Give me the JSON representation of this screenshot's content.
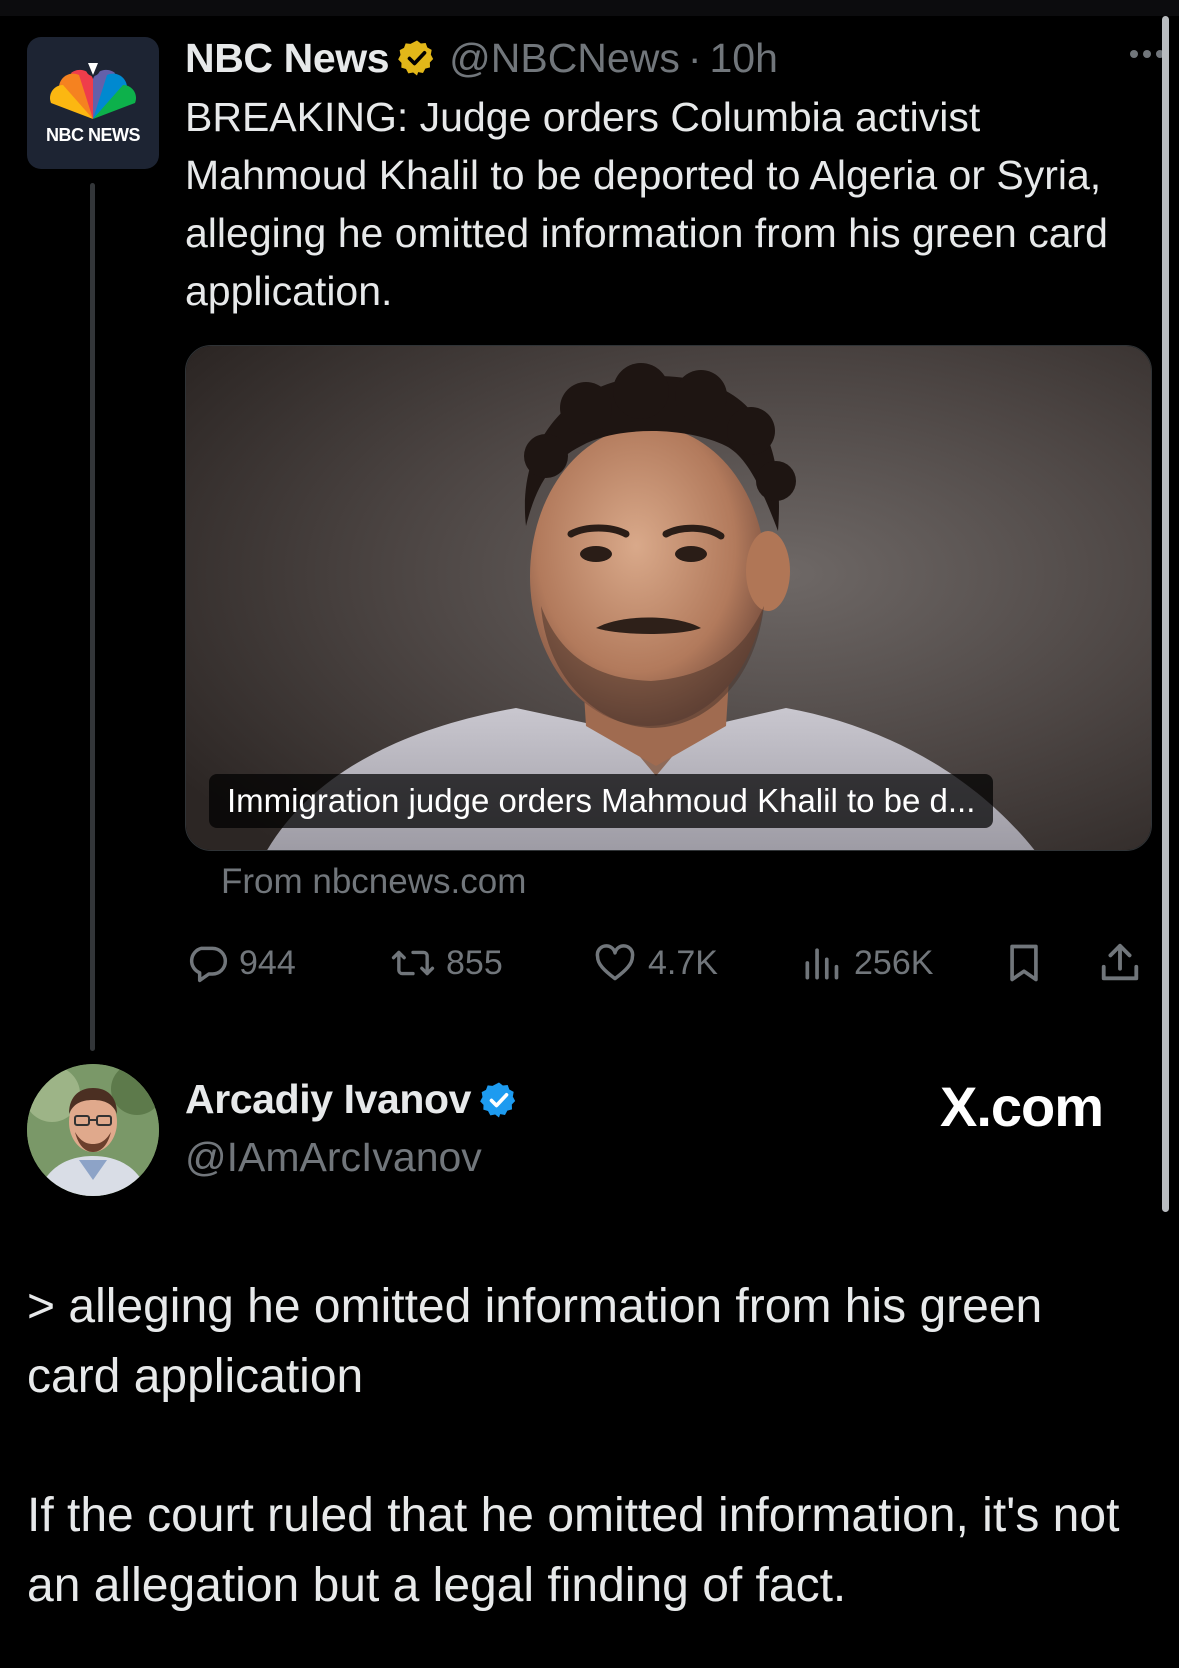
{
  "tweet": {
    "avatar_text": "NBC NEWS",
    "author_name": "NBC News",
    "badge": "gold-verified-badge",
    "handle": "@NBCNews",
    "separator": "·",
    "time": "10h",
    "text": "BREAKING: Judge orders Columbia activist Mahmoud Khalil to be deported to Algeria or Syria, alleging he omitted information from his green card application.",
    "card": {
      "caption": "Immigration judge orders Mahmoud Khalil to be d...",
      "source": "From nbcnews.com"
    },
    "stats": {
      "replies": "944",
      "reposts": "855",
      "likes": "4.7K",
      "views": "256K"
    }
  },
  "reply": {
    "author_name": "Arcadiy Ivanov",
    "badge": "blue-verified-badge",
    "handle": "@IAmArcIvanov",
    "site_label": "X.com",
    "paragraph1": "> alleging he omitted information from his green card application",
    "paragraph2": "If the court ruled that he omitted information, it's not an allegation but a legal finding of fact."
  },
  "colors": {
    "background": "#000000",
    "text": "#e7e9ea",
    "secondary": "#71767b",
    "gold_badge": "#e2b719",
    "blue_badge": "#1d9bf0"
  }
}
